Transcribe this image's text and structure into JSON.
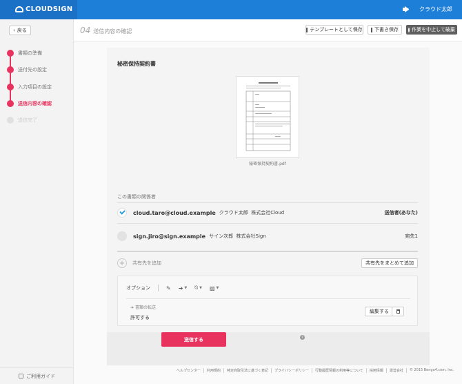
{
  "app": {
    "logo": "CLOUDSIGN",
    "user": "クラウド太郎"
  },
  "sidebar": {
    "back_label": "戻る",
    "steps": [
      {
        "label": "書類の準備",
        "state": "done"
      },
      {
        "label": "送付先の設定",
        "state": "done"
      },
      {
        "label": "入力項目の設定",
        "state": "done"
      },
      {
        "label": "送信内容の確認",
        "state": "active"
      },
      {
        "label": "送信完了",
        "state": "pending"
      }
    ],
    "guide_label": "ご利用ガイド"
  },
  "subheader": {
    "step_number": "04",
    "step_title": "送信内容の確認",
    "save_template": "テンプレートとして保存",
    "save_draft": "下書き保存",
    "abort": "作業を中止して破棄"
  },
  "document": {
    "title": "秘密保持契約書",
    "filename": "秘密保持契約書.pdf"
  },
  "parties": {
    "section_label": "この書類の関係者",
    "list": [
      {
        "email": "cloud.taro@cloud.example",
        "name": "クラウド太郎",
        "company": "株式会社Cloud",
        "role": "送信者(あなた)",
        "done": true
      },
      {
        "email": "sign.jiro@sign.example",
        "name": "サイン次郎",
        "company": "株式会社Sign",
        "role": "宛先1",
        "done": false
      }
    ],
    "add_share_label": "共有先を追加",
    "bulk_add_label": "共有先をまとめて追加"
  },
  "options": {
    "label": "オプション",
    "transfer_label": "書類の転送",
    "transfer_value": "許可する",
    "edit_label": "編集する"
  },
  "send_label": "送信する",
  "help_mark": "?",
  "footer": [
    "ヘルプセンター",
    "利用規約",
    "特定商取引法に基づく表記",
    "プライバシーポリシー",
    "行動履歴情報の利用等について",
    "採用情報",
    "運営会社",
    "© 2015 Bengo4.com, Inc."
  ]
}
